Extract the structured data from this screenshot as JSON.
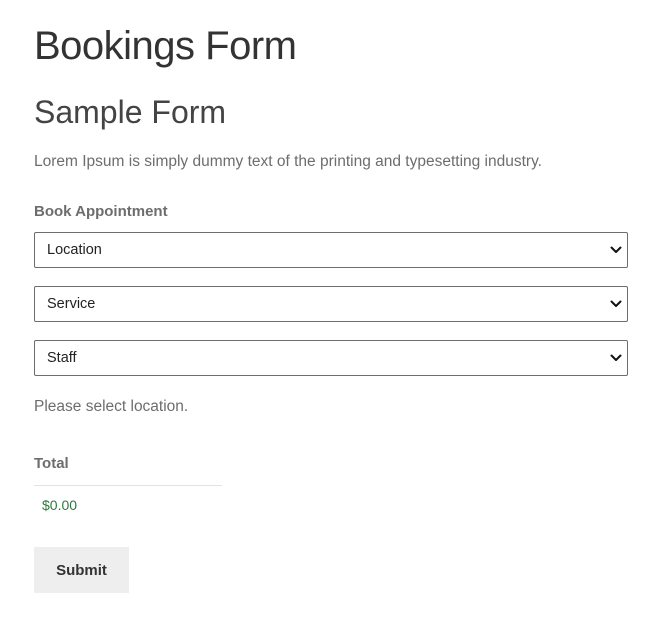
{
  "page": {
    "title": "Bookings Form"
  },
  "form": {
    "title": "Sample Form",
    "description": "Lorem Ipsum is simply dummy text of the printing and typesetting industry.",
    "field_label": "Book Appointment",
    "selects": {
      "location": "Location",
      "service": "Service",
      "staff": "Staff"
    },
    "status_message": "Please select location.",
    "total": {
      "label": "Total",
      "value": "$0.00"
    },
    "submit_label": "Submit"
  },
  "icons": {
    "dropdown": "chevron-down-icon"
  },
  "colors": {
    "text_primary": "#333333",
    "text_muted": "#6d6d6d",
    "price": "#2d7a3a",
    "button_bg": "#eeeeee",
    "select_border": "#6d6d6d"
  }
}
